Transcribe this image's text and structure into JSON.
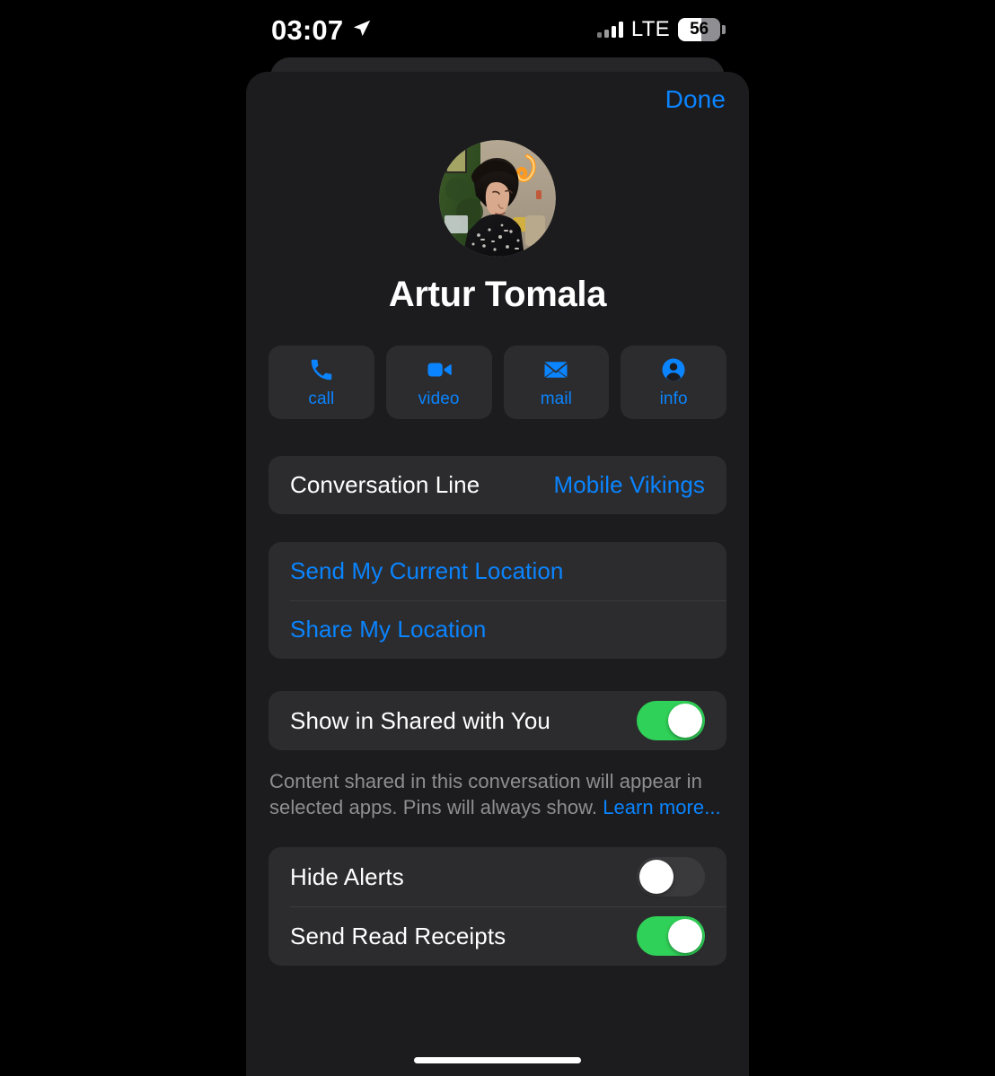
{
  "status_bar": {
    "time": "03:07",
    "location_icon": "location-arrow-icon",
    "signal_icon": "cellular-signal-icon",
    "network": "LTE",
    "battery_percent": "56",
    "battery_icon": "battery-icon"
  },
  "sheet": {
    "done_label": "Done"
  },
  "profile": {
    "name": "Artur Tomala",
    "avatar_icon": "contact-photo"
  },
  "actions": [
    {
      "label": "call",
      "icon": "phone-icon"
    },
    {
      "label": "video",
      "icon": "video-camera-icon"
    },
    {
      "label": "mail",
      "icon": "envelope-icon"
    },
    {
      "label": "info",
      "icon": "person-circle-icon"
    }
  ],
  "conversation_line": {
    "label": "Conversation Line",
    "value": "Mobile Vikings"
  },
  "location": {
    "send_current": "Send My Current Location",
    "share": "Share My Location"
  },
  "shared_with_you": {
    "label": "Show in Shared with You",
    "state": "on",
    "note_text": "Content shared in this conversation will appear in selected apps. Pins will always show. ",
    "note_link": "Learn more..."
  },
  "alerts": {
    "hide_alerts_label": "Hide Alerts",
    "hide_alerts_state": "off",
    "read_receipts_label": "Send Read Receipts",
    "read_receipts_state": "on"
  },
  "colors": {
    "accent_blue": "#0a84ff",
    "toggle_green": "#30d158",
    "sheet_bg": "#1c1c1e",
    "card_bg": "#2c2c2e",
    "secondary_text": "#8e8e93"
  }
}
